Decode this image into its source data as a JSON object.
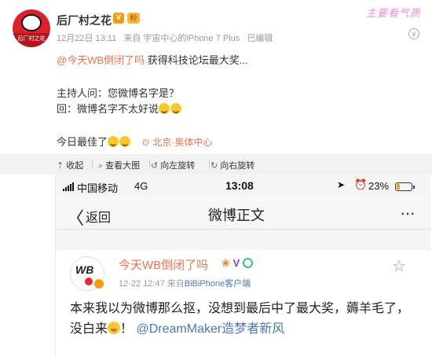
{
  "post": {
    "author": "后厂村之花",
    "avatar_caption": "后厂村之花",
    "verified_badge": "V",
    "fan_badge": "粉",
    "watermark": "主要看气质",
    "date": "12月22日 13:11",
    "source": "来自 宇宙中心的iPhone 7 Plus",
    "edited": "已编辑",
    "mention": "@今天WB倒闭了吗",
    "line1_text": " 获得科技论坛最大奖...",
    "line2": "主持人问：您微博名字是？",
    "line3": "回：微博名字不太好说",
    "line4": "今日最佳了",
    "location": "北京·奥体中心"
  },
  "toolbar": {
    "collapse": "收起",
    "view_large": "查看大图",
    "rotate_left": "向左旋转",
    "rotate_right": "向右旋转"
  },
  "phone": {
    "carrier": "中国移动",
    "network": "4G",
    "time": "13:08",
    "battery_pct": "23%",
    "battery_level": 0.23,
    "back_label": "返回",
    "title": "微博正文",
    "more_glyph": "···"
  },
  "card": {
    "avatar_text": "WB",
    "name": "今天WB倒闭了吗",
    "badge_v": "V",
    "date": "12-22 12:47",
    "source_prefix": "来自",
    "client": "BiBiPhone客户端",
    "text_main": "本来我以为微博那么抠，没想到最后中了最大奖，薅羊毛了，没白来",
    "text_tail": "！",
    "mention": "@DreamMaker造梦者新风"
  },
  "icons": {
    "location": "location-pin-icon",
    "collapse": "collapse-icon",
    "search": "magnifier-icon",
    "rotate_left": "rotate-left-icon",
    "rotate_right": "rotate-right-icon",
    "star": "star-icon"
  },
  "colors": {
    "accent_orange": "#eb7350",
    "link_blue": "#4a76b8",
    "meta_gray": "#999999"
  }
}
